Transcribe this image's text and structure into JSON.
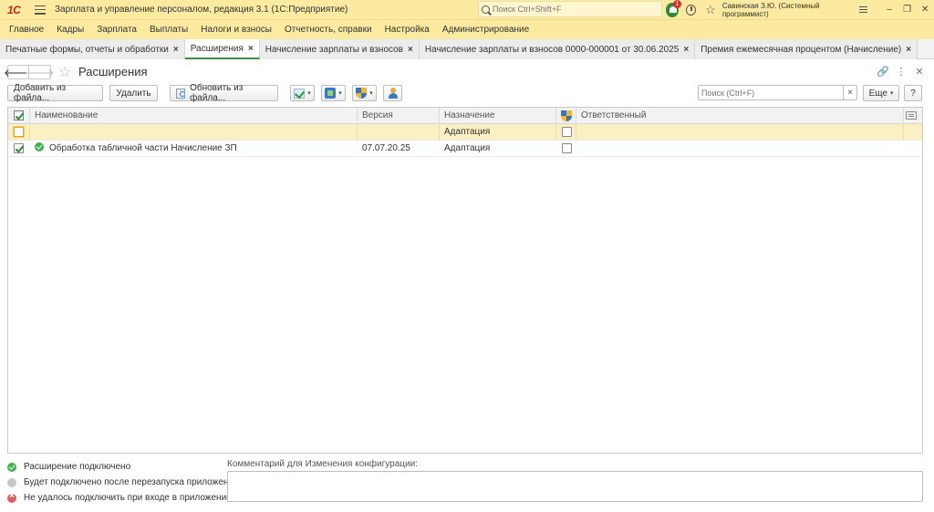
{
  "window": {
    "logo_text": "1С",
    "title": "Зарплата и управление персоналом, редакция 3.1  (1С:Предприятие)",
    "search_placeholder": "Поиск Ctrl+Shift+F",
    "notifications_count": "1",
    "user": "Савинская З.Ю. (Системный программист)",
    "minimize": "–",
    "restore": "❐",
    "close": "✕"
  },
  "menu": [
    "Главное",
    "Кадры",
    "Зарплата",
    "Выплаты",
    "Налоги и взносы",
    "Отчетность, справки",
    "Настройка",
    "Администрирование"
  ],
  "tabs": [
    {
      "label": "Печатные формы, отчеты и обработки"
    },
    {
      "label": "Расширения"
    },
    {
      "label": "Начисление зарплаты и взносов"
    },
    {
      "label": "Начисление зарплаты и взносов 0000-000001 от 30.06.2025"
    },
    {
      "label": "Премия ежемесячная процентом (Начисление)"
    }
  ],
  "form": {
    "title": "Расширения",
    "back": "🡐",
    "forward": "🡒",
    "link_icon": "🔗",
    "menu_icon": "⋮",
    "close_icon": "✕"
  },
  "toolbar": {
    "add_from_file": "Добавить из файла...",
    "delete": "Удалить",
    "update_from_file": "Обновить из файла...",
    "search_placeholder": "Поиск (Ctrl+F)",
    "clear": "×",
    "more": "Еще",
    "help": "?"
  },
  "table": {
    "columns": {
      "name": "Наименование",
      "version": "Версия",
      "purpose": "Назначение",
      "responsible": "Ответственный"
    },
    "rows": [
      {
        "active": false,
        "status": "",
        "name": "",
        "version": "",
        "purpose": "Адаптация",
        "safe_mode": false,
        "responsible": ""
      },
      {
        "active": true,
        "status": "connected",
        "name": "Обработка табличной части Начисление ЗП",
        "version": "07.07.20.25",
        "purpose": "Адаптация",
        "safe_mode": false,
        "responsible": ""
      }
    ]
  },
  "legend": {
    "connected": "Расширение подключено",
    "after_restart": "Будет подключено после перезапуска приложения",
    "failed": "Не удалось подключить при входе в приложение"
  },
  "comment": {
    "label": "Комментарий для Изменения конфигурации:",
    "value": ""
  }
}
